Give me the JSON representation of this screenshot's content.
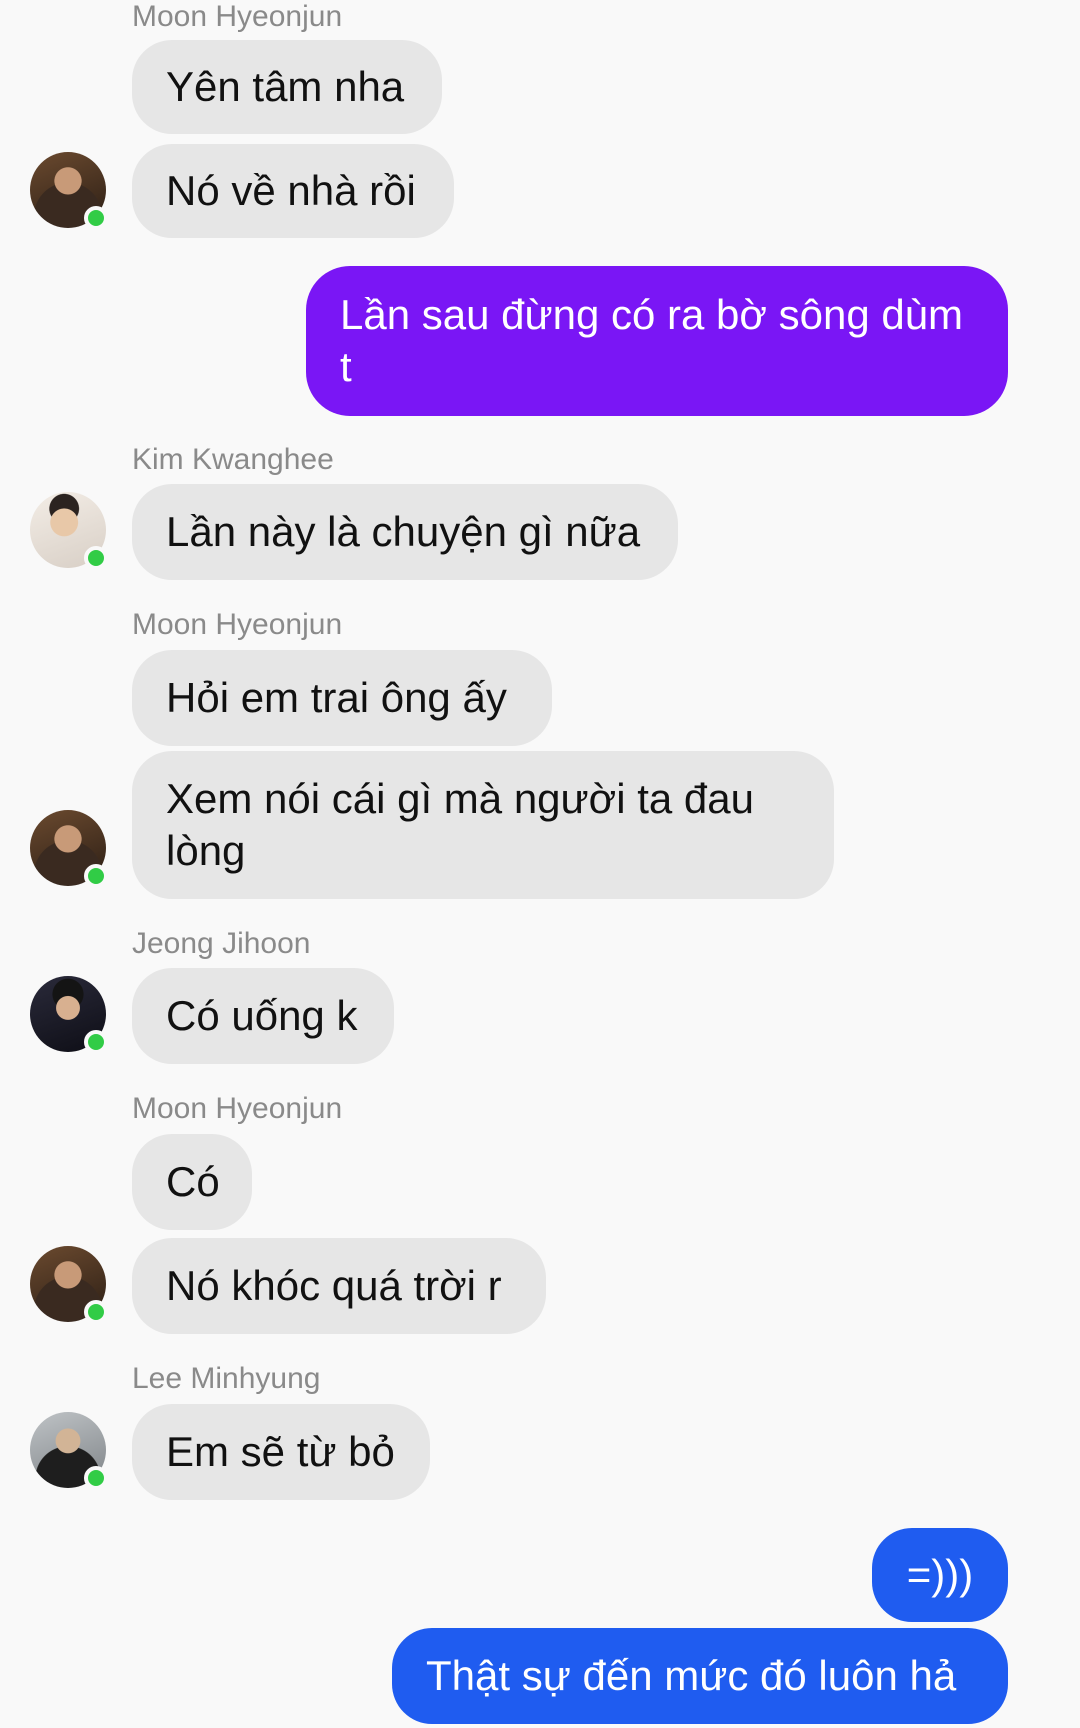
{
  "colors": {
    "incoming_bubble": "#e6e6e6",
    "outgoing_purple": "#7a16f5",
    "outgoing_blue": "#1f5cf0",
    "online_dot": "#31cc46",
    "sender_name": "#8a8a8a"
  },
  "messages": [
    {
      "sender": "Moon Hyeonjun",
      "text": "Yên tâm nha"
    },
    {
      "text": "Nó về nhà rồi"
    },
    {
      "text": "Lần sau đừng có ra bờ sông dùm t"
    },
    {
      "sender": "Kim Kwanghee",
      "text": "Lần này là chuyện gì nữa"
    },
    {
      "sender": "Moon Hyeonjun",
      "text": "Hỏi em trai ông ấy"
    },
    {
      "text": "Xem nói cái gì mà người ta đau lòng"
    },
    {
      "sender": "Jeong Jihoon",
      "text": "Có uống k"
    },
    {
      "sender": "Moon Hyeonjun",
      "text": "Có"
    },
    {
      "text": "Nó khóc quá trời r"
    },
    {
      "sender": "Lee Minhyung",
      "text": "Em sẽ từ bỏ"
    },
    {
      "text": "=)))"
    },
    {
      "text": "Thật sự đến mức đó luôn hả"
    }
  ]
}
